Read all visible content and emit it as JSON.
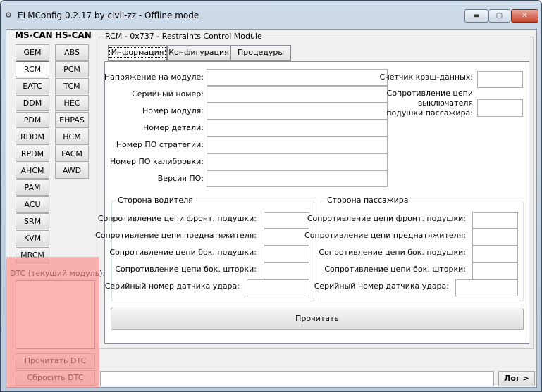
{
  "window": {
    "title": "ELMConfig 0.2.17 by civil-zz - Offline mode",
    "min_glyph": "▬",
    "max_glyph": "▢",
    "close_glyph": "✕"
  },
  "ms_can": {
    "header": "MS-CAN",
    "modules": [
      "GEM",
      "RCM",
      "EATC",
      "DDM",
      "PDM",
      "RDDM",
      "RPDM",
      "AHCM",
      "PAM",
      "ACU",
      "SRM",
      "KVM",
      "MRCM"
    ],
    "selected": "RCM"
  },
  "hs_can": {
    "header": "HS-CAN",
    "modules": [
      "ABS",
      "PCM",
      "TCM",
      "HEC",
      "EHPAS",
      "HCM",
      "FACM",
      "AWD"
    ]
  },
  "dtc": {
    "label": "DTC (текущий модуль):",
    "read_button": "Прочитать DTC",
    "reset_button": "Сбросить DTC"
  },
  "module_group": {
    "title": "RCM - 0x737 - Restraints Control Module",
    "tabs": [
      "Информация",
      "Конфигурация",
      "Процедуры"
    ],
    "active_tab": "Информация"
  },
  "info": {
    "left_fields": [
      {
        "label": "Напряжение на модуле:",
        "value": ""
      },
      {
        "label": "Серийный номер:",
        "value": ""
      },
      {
        "label": "Номер модуля:",
        "value": ""
      },
      {
        "label": "Номер детали:",
        "value": ""
      },
      {
        "label": "Номер ПО стратегии:",
        "value": ""
      },
      {
        "label": "Номер ПО калибровки:",
        "value": ""
      },
      {
        "label": "Версия ПО:",
        "value": ""
      }
    ],
    "crash_counter_label": "Счетчик крэш-данных:",
    "passenger_switch_label_1": "Сопротивление цепи",
    "passenger_switch_label_2": "выключателя",
    "passenger_switch_label_3": "подушки пассажира:"
  },
  "driver_side": {
    "title": "Сторона водителя",
    "fields": [
      "Сопротивление цепи фронт. подушки:",
      "Сопротивление цепи преднатяжителя:",
      "Сопротивление цепи бок. подушки:",
      "Сопротивление цепи бок. шторки:",
      "Серийный номер датчика удара:"
    ]
  },
  "passenger_side": {
    "title": "Сторона пассажира",
    "fields": [
      "Сопротивление цепи фронт. подушки:",
      "Сопротивление цепи преднатяжителя:",
      "Сопротивление цепи бок. подушки:",
      "Сопротивление цепи бок. шторки:",
      "Серийный номер датчика удара:"
    ]
  },
  "read_button": "Прочитать",
  "log_button": "Лог >"
}
